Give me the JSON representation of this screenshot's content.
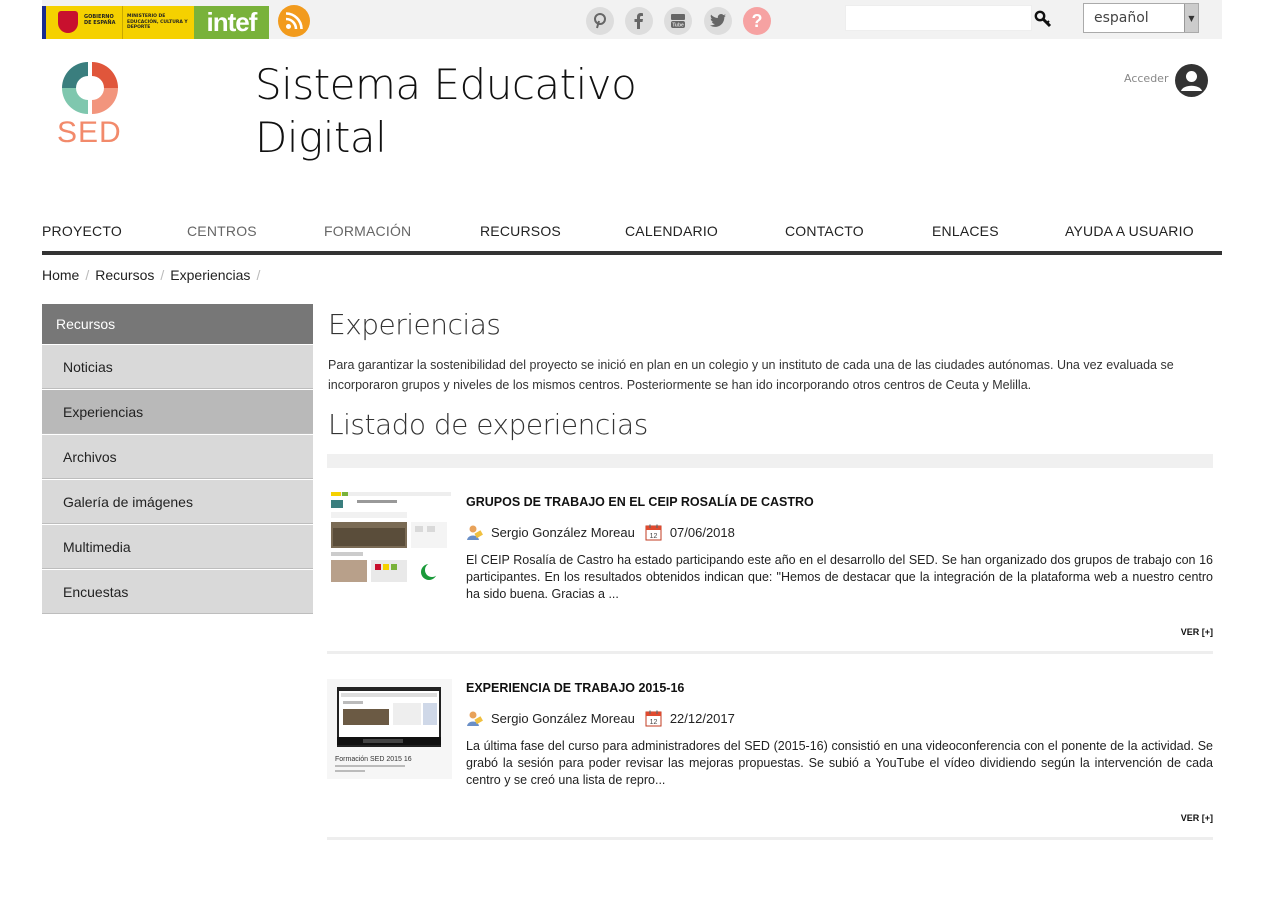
{
  "topbar": {
    "gov_line1": "GOBIERNO DE ESPAÑA",
    "ministry": "MINISTERIO DE EDUCACIÓN, CULTURA Y DEPORTE",
    "intef": "intef",
    "language": "español",
    "search_value": ""
  },
  "header": {
    "logo_text": "SED",
    "title": "Sistema Educativo Digital",
    "login_label": "Acceder"
  },
  "nav": {
    "items": [
      "PROYECTO",
      "CENTROS",
      "FORMACIÓN",
      "RECURSOS",
      "CALENDARIO",
      "CONTACTO",
      "ENLACES",
      "AYUDA A USUARIO"
    ]
  },
  "breadcrumb": [
    "Home",
    "Recursos",
    "Experiencias"
  ],
  "sidebar": {
    "heading": "Recursos",
    "items": [
      "Noticias",
      "Experiencias",
      "Archivos",
      "Galería de imágenes",
      "Multimedia",
      "Encuestas"
    ]
  },
  "main": {
    "title": "Experiencias",
    "intro": "Para garantizar la sostenibilidad del proyecto se inició en plan en un colegio y un instituto de cada una de las ciudades autónomas. Una vez evaluada se incorporaron grupos y niveles de los mismos centros. Posteriormente se han ido incorporando otros centros de Ceuta y Melilla.",
    "list_title": "Listado de experiencias",
    "experiences": [
      {
        "title": "GRUPOS DE TRABAJO EN EL CEIP ROSALÍA DE CASTRO",
        "author": "Sergio González Moreau",
        "date": "07/06/2018",
        "excerpt": "El CEIP Rosalía de Castro ha estado participando este año en el desarrollo del SED. Se han organizado dos grupos de trabajo con 16 participantes. En los resultados obtenidos indican que: \"Hemos de destacar que la integración de la plataforma web a nuestro centro ha sido buena. Gracias a ...",
        "more": "VER [+]"
      },
      {
        "title": "EXPERIENCIA DE TRABAJO 2015-16",
        "author": "Sergio González Moreau",
        "date": "22/12/2017",
        "excerpt": "La última fase del curso para administradores del SED (2015-16) consistió en una videoconferencia con el ponente de la actividad. Se grabó la sesión para poder revisar las mejoras propuestas. Se subió a YouTube el vídeo dividiendo según la intervención de cada centro y se creó una lista de repro...",
        "more": "VER [+]",
        "thumb_caption": "Formación SED 2015 16"
      }
    ]
  },
  "colors": {
    "rss": "#f29b1d",
    "intef": "#79b23a",
    "gov_yellow": "#f5d100",
    "sidebar_head": "#777777",
    "sidebar_item": "#d9d9d9",
    "sidebar_active": "#b9b9b9",
    "sed_orange": "#f28a6b",
    "sed_teal": "#2f6b6b"
  },
  "icons": [
    "rss-icon",
    "pinterest-icon",
    "facebook-icon",
    "youtube-icon",
    "twitter-icon",
    "help-icon",
    "search-icon",
    "user-icon",
    "author-icon",
    "calendar-icon"
  ]
}
